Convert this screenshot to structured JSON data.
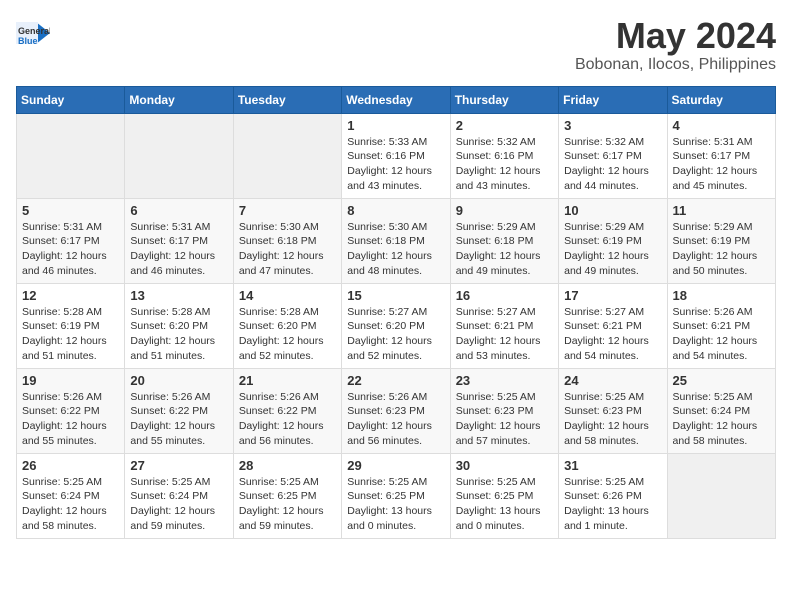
{
  "logo": {
    "general": "General",
    "blue": "Blue"
  },
  "title": "May 2024",
  "subtitle": "Bobonan, Ilocos, Philippines",
  "days_header": [
    "Sunday",
    "Monday",
    "Tuesday",
    "Wednesday",
    "Thursday",
    "Friday",
    "Saturday"
  ],
  "weeks": [
    [
      {
        "day": "",
        "info": ""
      },
      {
        "day": "",
        "info": ""
      },
      {
        "day": "",
        "info": ""
      },
      {
        "day": "1",
        "info": "Sunrise: 5:33 AM\nSunset: 6:16 PM\nDaylight: 12 hours\nand 43 minutes."
      },
      {
        "day": "2",
        "info": "Sunrise: 5:32 AM\nSunset: 6:16 PM\nDaylight: 12 hours\nand 43 minutes."
      },
      {
        "day": "3",
        "info": "Sunrise: 5:32 AM\nSunset: 6:17 PM\nDaylight: 12 hours\nand 44 minutes."
      },
      {
        "day": "4",
        "info": "Sunrise: 5:31 AM\nSunset: 6:17 PM\nDaylight: 12 hours\nand 45 minutes."
      }
    ],
    [
      {
        "day": "5",
        "info": "Sunrise: 5:31 AM\nSunset: 6:17 PM\nDaylight: 12 hours\nand 46 minutes."
      },
      {
        "day": "6",
        "info": "Sunrise: 5:31 AM\nSunset: 6:17 PM\nDaylight: 12 hours\nand 46 minutes."
      },
      {
        "day": "7",
        "info": "Sunrise: 5:30 AM\nSunset: 6:18 PM\nDaylight: 12 hours\nand 47 minutes."
      },
      {
        "day": "8",
        "info": "Sunrise: 5:30 AM\nSunset: 6:18 PM\nDaylight: 12 hours\nand 48 minutes."
      },
      {
        "day": "9",
        "info": "Sunrise: 5:29 AM\nSunset: 6:18 PM\nDaylight: 12 hours\nand 49 minutes."
      },
      {
        "day": "10",
        "info": "Sunrise: 5:29 AM\nSunset: 6:19 PM\nDaylight: 12 hours\nand 49 minutes."
      },
      {
        "day": "11",
        "info": "Sunrise: 5:29 AM\nSunset: 6:19 PM\nDaylight: 12 hours\nand 50 minutes."
      }
    ],
    [
      {
        "day": "12",
        "info": "Sunrise: 5:28 AM\nSunset: 6:19 PM\nDaylight: 12 hours\nand 51 minutes."
      },
      {
        "day": "13",
        "info": "Sunrise: 5:28 AM\nSunset: 6:20 PM\nDaylight: 12 hours\nand 51 minutes."
      },
      {
        "day": "14",
        "info": "Sunrise: 5:28 AM\nSunset: 6:20 PM\nDaylight: 12 hours\nand 52 minutes."
      },
      {
        "day": "15",
        "info": "Sunrise: 5:27 AM\nSunset: 6:20 PM\nDaylight: 12 hours\nand 52 minutes."
      },
      {
        "day": "16",
        "info": "Sunrise: 5:27 AM\nSunset: 6:21 PM\nDaylight: 12 hours\nand 53 minutes."
      },
      {
        "day": "17",
        "info": "Sunrise: 5:27 AM\nSunset: 6:21 PM\nDaylight: 12 hours\nand 54 minutes."
      },
      {
        "day": "18",
        "info": "Sunrise: 5:26 AM\nSunset: 6:21 PM\nDaylight: 12 hours\nand 54 minutes."
      }
    ],
    [
      {
        "day": "19",
        "info": "Sunrise: 5:26 AM\nSunset: 6:22 PM\nDaylight: 12 hours\nand 55 minutes."
      },
      {
        "day": "20",
        "info": "Sunrise: 5:26 AM\nSunset: 6:22 PM\nDaylight: 12 hours\nand 55 minutes."
      },
      {
        "day": "21",
        "info": "Sunrise: 5:26 AM\nSunset: 6:22 PM\nDaylight: 12 hours\nand 56 minutes."
      },
      {
        "day": "22",
        "info": "Sunrise: 5:26 AM\nSunset: 6:23 PM\nDaylight: 12 hours\nand 56 minutes."
      },
      {
        "day": "23",
        "info": "Sunrise: 5:25 AM\nSunset: 6:23 PM\nDaylight: 12 hours\nand 57 minutes."
      },
      {
        "day": "24",
        "info": "Sunrise: 5:25 AM\nSunset: 6:23 PM\nDaylight: 12 hours\nand 58 minutes."
      },
      {
        "day": "25",
        "info": "Sunrise: 5:25 AM\nSunset: 6:24 PM\nDaylight: 12 hours\nand 58 minutes."
      }
    ],
    [
      {
        "day": "26",
        "info": "Sunrise: 5:25 AM\nSunset: 6:24 PM\nDaylight: 12 hours\nand 58 minutes."
      },
      {
        "day": "27",
        "info": "Sunrise: 5:25 AM\nSunset: 6:24 PM\nDaylight: 12 hours\nand 59 minutes."
      },
      {
        "day": "28",
        "info": "Sunrise: 5:25 AM\nSunset: 6:25 PM\nDaylight: 12 hours\nand 59 minutes."
      },
      {
        "day": "29",
        "info": "Sunrise: 5:25 AM\nSunset: 6:25 PM\nDaylight: 13 hours\nand 0 minutes."
      },
      {
        "day": "30",
        "info": "Sunrise: 5:25 AM\nSunset: 6:25 PM\nDaylight: 13 hours\nand 0 minutes."
      },
      {
        "day": "31",
        "info": "Sunrise: 5:25 AM\nSunset: 6:26 PM\nDaylight: 13 hours\nand 1 minute."
      },
      {
        "day": "",
        "info": ""
      }
    ]
  ]
}
